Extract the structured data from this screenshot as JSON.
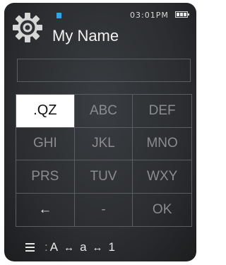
{
  "status_bar": {
    "time": "03:01PM",
    "indicator_color": "#2aa9e6",
    "battery_level": 1.0
  },
  "header": {
    "icon": "gear-icon",
    "title": "My Name"
  },
  "input": {
    "value": "",
    "placeholder": ""
  },
  "keypad": {
    "keys": [
      {
        "label": ".QZ",
        "selected": true
      },
      {
        "label": "ABC"
      },
      {
        "label": "DEF"
      },
      {
        "label": "GHI"
      },
      {
        "label": "JKL"
      },
      {
        "label": "MNO"
      },
      {
        "label": "PRS"
      },
      {
        "label": "TUV"
      },
      {
        "label": "WXY"
      },
      {
        "label": "←",
        "icon": "backspace-arrow-icon"
      },
      {
        "label": "-"
      },
      {
        "label": "OK"
      }
    ]
  },
  "bottom_bar": {
    "icon": "menu-icon",
    "colon": ":",
    "modes": [
      "A",
      "a",
      "1"
    ],
    "separator": "↔"
  },
  "colors": {
    "background": "#2b2d30",
    "grid_line": "#5a5d61",
    "key_text": "#8a8c8f",
    "selected_key_bg": "#ffffff"
  }
}
